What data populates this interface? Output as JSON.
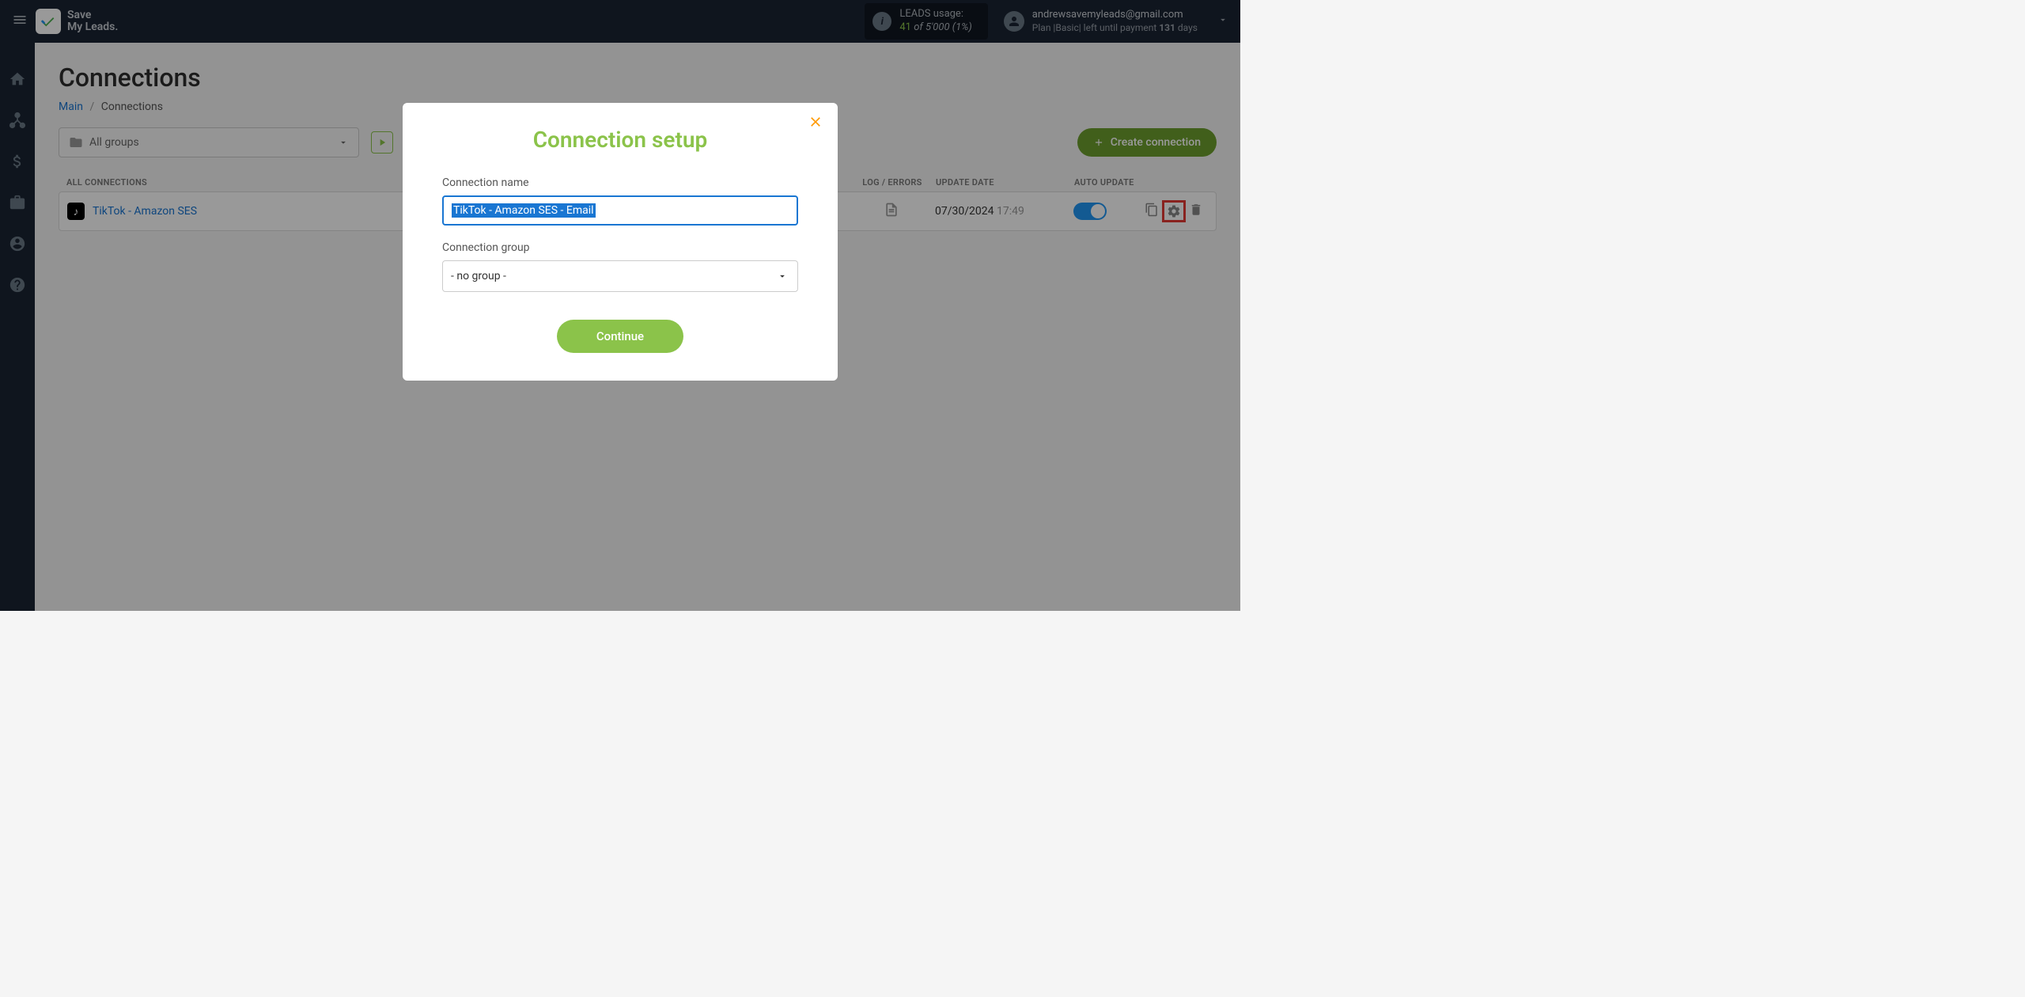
{
  "header": {
    "logo_line1": "Save",
    "logo_line2": "My Leads",
    "leads_title": "LEADS usage:",
    "leads_used": "41",
    "leads_of": "of",
    "leads_total": "5'000",
    "leads_percent": "(1%)",
    "user_email": "andrewsavemyleads@gmail.com",
    "user_plan_prefix": "Plan |",
    "user_plan_name": "Basic",
    "user_plan_mid": "| left until payment ",
    "user_plan_days": "131",
    "user_plan_suffix": " days"
  },
  "page": {
    "title": "Connections",
    "breadcrumb_main": "Main",
    "breadcrumb_sep": "/",
    "breadcrumb_current": "Connections",
    "group_select": "All groups",
    "create_button": "Create connection"
  },
  "table": {
    "header_all": "ALL CONNECTIONS",
    "header_log": "LOG / ERRORS",
    "header_date": "UPDATE DATE",
    "header_auto": "AUTO UPDATE",
    "row_name": "TikTok - Amazon SES",
    "row_date": "07/30/2024",
    "row_time": "17:49"
  },
  "modal": {
    "title": "Connection setup",
    "name_label": "Connection name",
    "name_value": "TikTok - Amazon SES - Email",
    "group_label": "Connection group",
    "group_value": "- no group -",
    "continue": "Continue"
  }
}
